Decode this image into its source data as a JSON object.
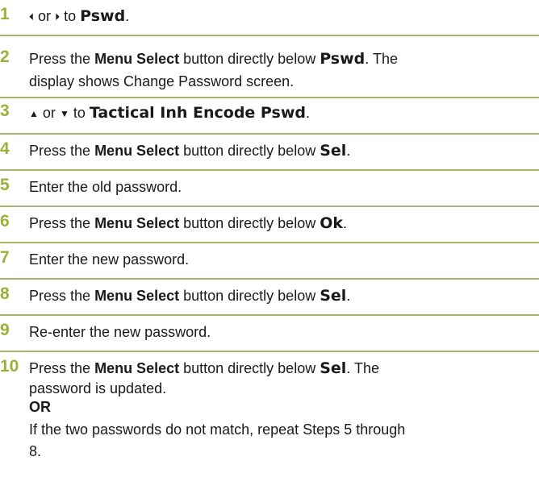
{
  "steps": [
    {
      "number": "1",
      "left_arrow": "⏴",
      "or": "or",
      "right_arrow": "⏵",
      "to": "to",
      "target": "Pswd",
      "end": "."
    },
    {
      "number": "2",
      "press": "Press the",
      "button": "Menu Select",
      "below": "button directly below",
      "target": "Pswd",
      "end": ". The",
      "line2": "display shows Change Password screen."
    },
    {
      "number": "3",
      "up_arrow": "▲",
      "or": "or",
      "down_arrow": "▼",
      "to": "to",
      "target": "Tactical Inh Encode Pswd",
      "end": "."
    },
    {
      "number": "4",
      "press": "Press the",
      "button": "Menu Select",
      "below": "button directly below",
      "target": "Sel",
      "end": "."
    },
    {
      "number": "5",
      "text": "Enter the old password."
    },
    {
      "number": "6",
      "press": "Press the",
      "button": "Menu Select",
      "below": "button directly below",
      "target": "Ok",
      "end": "."
    },
    {
      "number": "7",
      "text": "Enter the new password."
    },
    {
      "number": "8",
      "press": "Press the",
      "button": "Menu Select",
      "below": "button directly below",
      "target": "Sel",
      "end": "."
    },
    {
      "number": "9",
      "text": "Re-enter the new password."
    },
    {
      "number": "10",
      "press": "Press the",
      "button": "Menu Select",
      "below": "button directly below",
      "target": "Sel",
      "end": ". The",
      "line2": "password is updated.",
      "or_label": "OR",
      "line4": "If the two passwords do not match, repeat Steps 5 through",
      "line5": "8."
    }
  ],
  "colors": {
    "step_number": "#9bb03c",
    "divider": "#a5b56a",
    "text": "#1a1a1a"
  }
}
